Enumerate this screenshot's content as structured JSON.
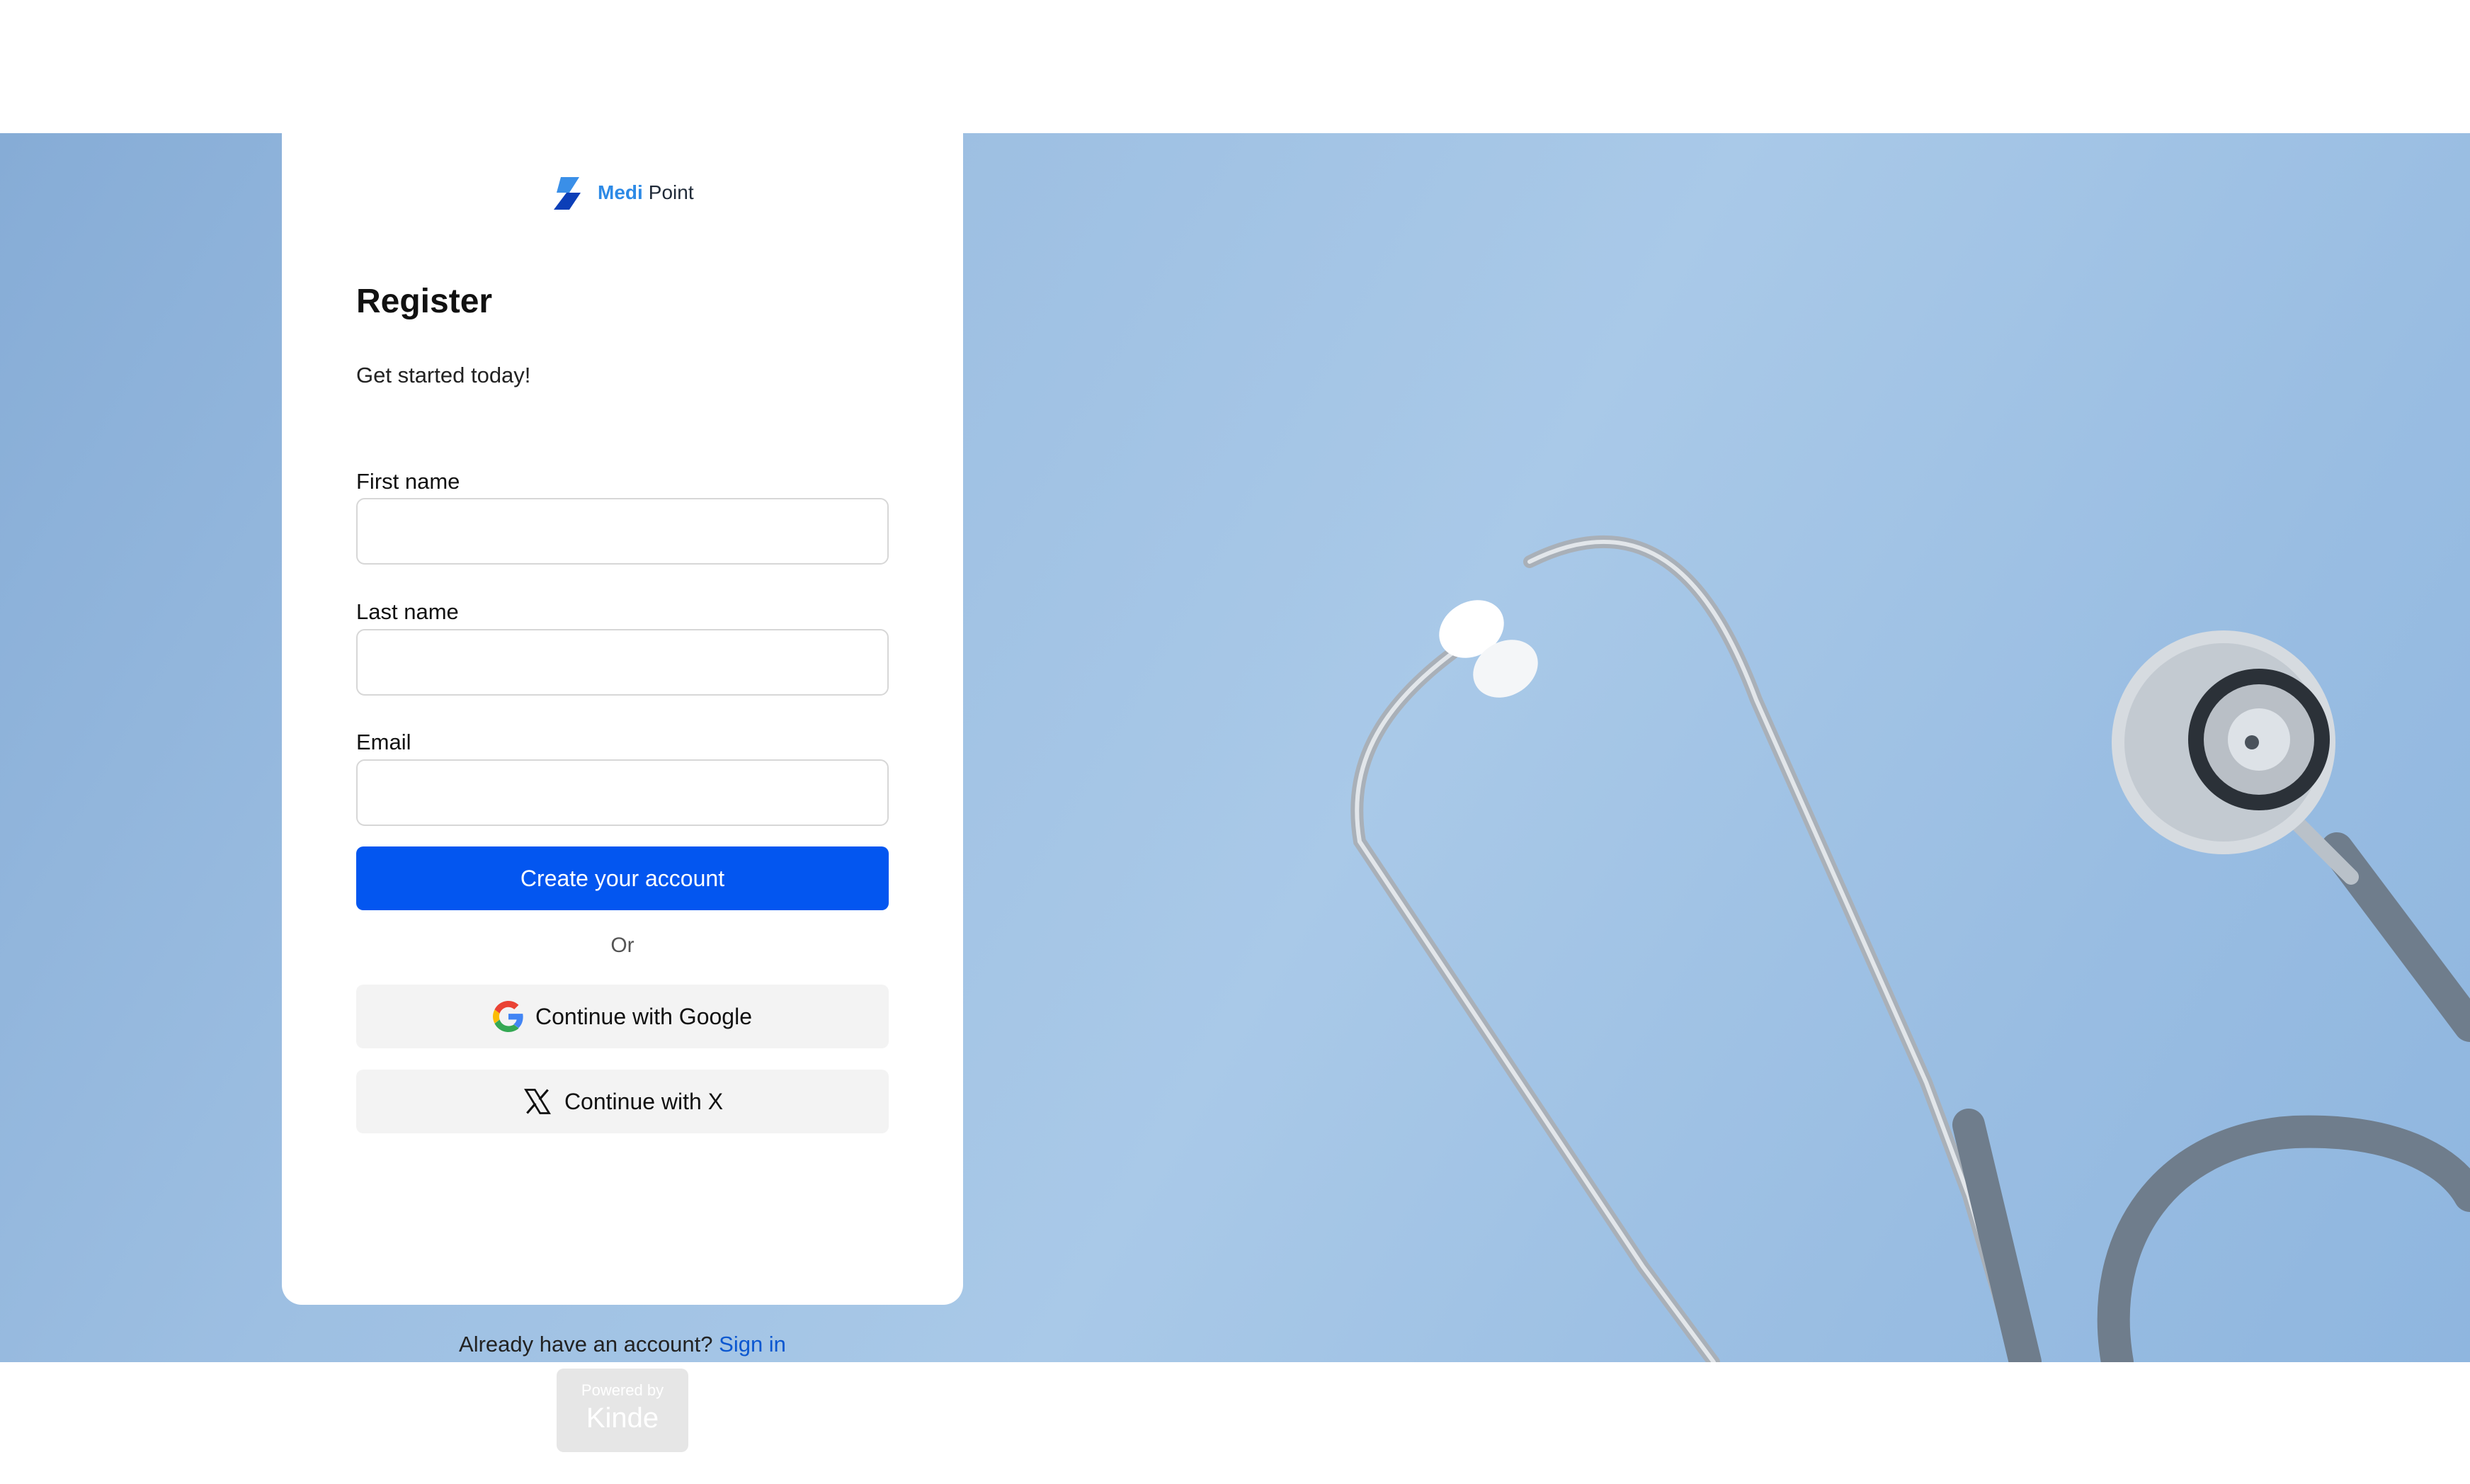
{
  "brand": {
    "name_part1": "Medi",
    "name_part2": "Point",
    "logo_icon": "lightning-bolt-icon"
  },
  "form": {
    "title": "Register",
    "subtitle": "Get started today!",
    "first_name_label": "First name",
    "first_name_value": "",
    "last_name_label": "Last name",
    "last_name_value": "",
    "email_label": "Email",
    "email_value": "",
    "submit_label": "Create your account",
    "divider_text": "Or",
    "google_label": "Continue with Google",
    "x_label": "Continue with X"
  },
  "footer": {
    "signin_prompt": "Already have an account?",
    "signin_link": "Sign in",
    "powered_by": "Powered by",
    "powered_brand": "Kinde"
  },
  "hero": {
    "image": "stethoscope-on-blue-background"
  },
  "colors": {
    "primary": "#0356f0",
    "brand_accent": "#2d8ae6",
    "link": "#0b57d0",
    "hero_bg": "#9dbfe2"
  }
}
